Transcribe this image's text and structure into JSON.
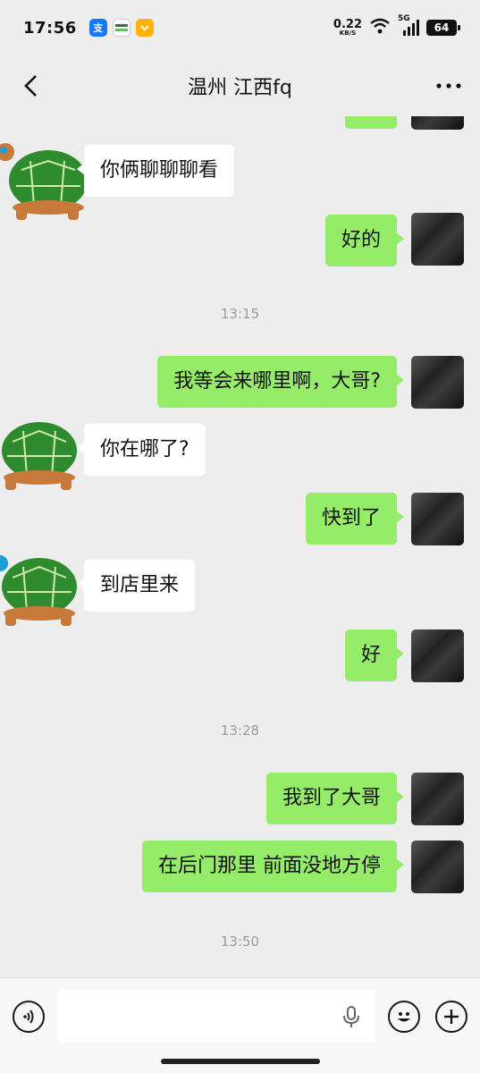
{
  "status_bar": {
    "time": "17:56",
    "net_speed_value": "0.22",
    "net_speed_unit": "KB/S",
    "network": "5G",
    "battery": "64",
    "app_icons": [
      "alipay-icon",
      "oppo-icon",
      "coupon-icon"
    ]
  },
  "header": {
    "title": "温州 江西fq"
  },
  "messages": [
    {
      "from": "them",
      "text": "你俩聊聊聊看"
    },
    {
      "from": "me",
      "text": "好的"
    },
    {
      "type": "time",
      "text": "13:15"
    },
    {
      "from": "me",
      "text": "我等会来哪里啊，大哥?"
    },
    {
      "from": "them",
      "text": "你在哪了?"
    },
    {
      "from": "me",
      "text": "快到了"
    },
    {
      "from": "them",
      "text": "到店里来"
    },
    {
      "from": "me",
      "text": "好"
    },
    {
      "type": "time",
      "text": "13:28"
    },
    {
      "from": "me",
      "text": "我到了大哥"
    },
    {
      "from": "me",
      "text": "在后门那里  前面没地方停"
    },
    {
      "type": "time",
      "text": "13:50"
    }
  ],
  "input_bar": {
    "placeholder": "",
    "left_button": "voice-icon",
    "right_buttons": [
      "emoji-icon",
      "plus-icon"
    ]
  },
  "colors": {
    "background": "#ededed",
    "bubble_me": "#95ec69",
    "bubble_them": "#ffffff",
    "timestamp": "#9a9a9a"
  }
}
